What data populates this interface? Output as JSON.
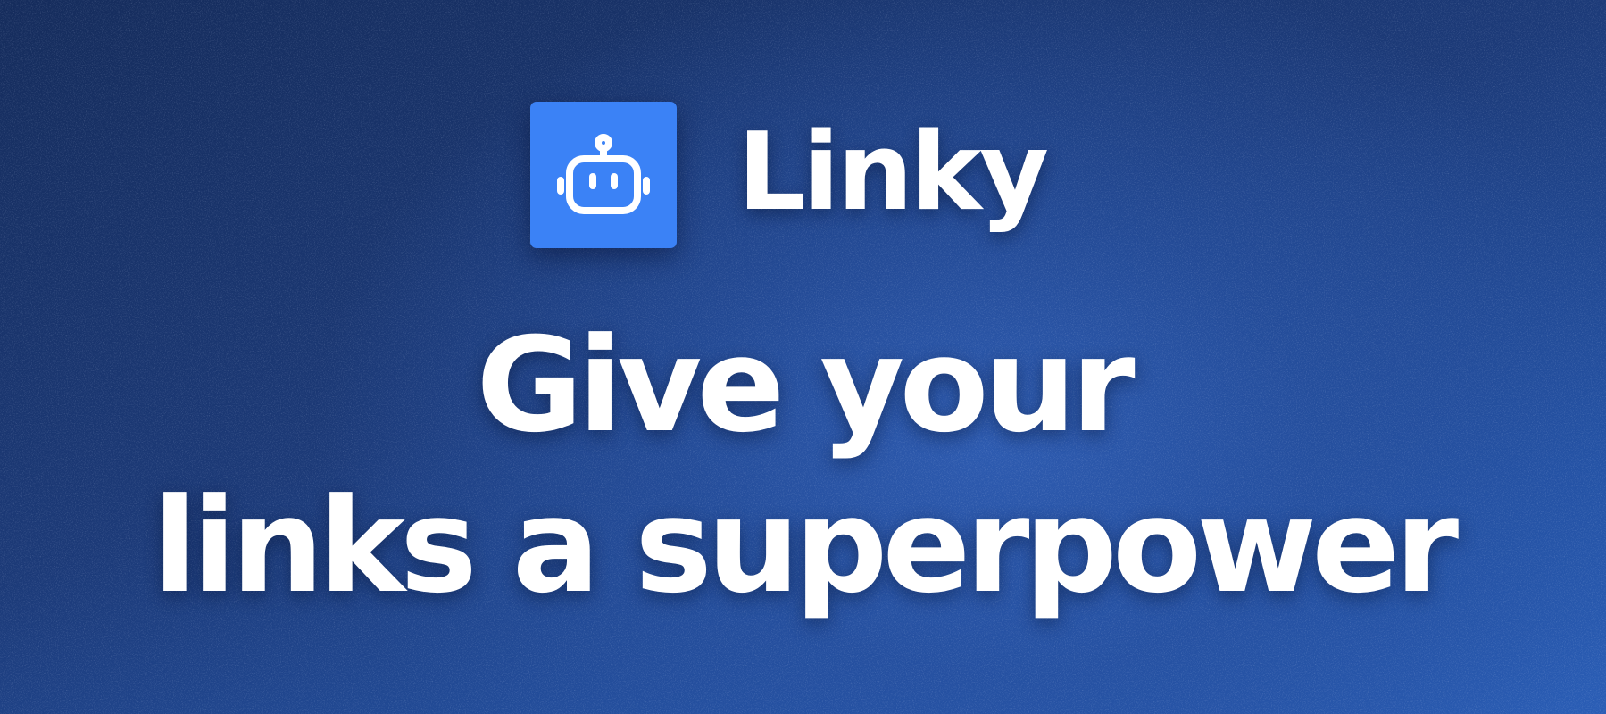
{
  "brand": {
    "name": "Linky",
    "logo_icon": "robot-icon",
    "logo_color": "#3b82f6"
  },
  "headline": {
    "line1": "Give your",
    "line2": "links a superpower"
  },
  "colors": {
    "background_dark": "#152c5c",
    "background_light": "#2a5db5",
    "text": "#ffffff"
  }
}
